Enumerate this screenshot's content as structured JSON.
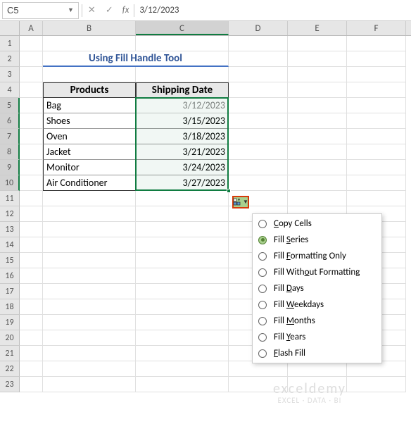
{
  "cell_ref": "C5",
  "formula_value": "3/12/2023",
  "columns": [
    "A",
    "B",
    "C",
    "D",
    "E",
    "F"
  ],
  "rows": [
    "1",
    "2",
    "3",
    "4",
    "5",
    "6",
    "7",
    "8",
    "9",
    "10",
    "11",
    "12",
    "13",
    "14",
    "15",
    "16",
    "17",
    "18",
    "19",
    "20",
    "21",
    "22",
    "23"
  ],
  "title": "Using Fill Handle Tool",
  "headers": {
    "products": "Products",
    "shipping": "Shipping Date"
  },
  "table": [
    {
      "product": "Bag",
      "date": "3/12/2023"
    },
    {
      "product": "Shoes",
      "date": "3/15/2023"
    },
    {
      "product": "Oven",
      "date": "3/18/2023"
    },
    {
      "product": "Jacket",
      "date": "3/21/2023"
    },
    {
      "product": "Monitor",
      "date": "3/24/2023"
    },
    {
      "product": "Air Conditioner",
      "date": "3/27/2023"
    }
  ],
  "menu": {
    "copy": "Copy Cells",
    "series": "Fill Series",
    "fmt_only": "Fill Formatting Only",
    "no_fmt": "Fill Without Formatting",
    "days": "Fill Days",
    "weekdays": "Fill Weekdays",
    "months": "Fill Months",
    "years": "Fill Years",
    "flash": "Flash Fill"
  },
  "watermark": {
    "brand": "exceldemy",
    "tag": "EXCEL · DATA · BI"
  }
}
